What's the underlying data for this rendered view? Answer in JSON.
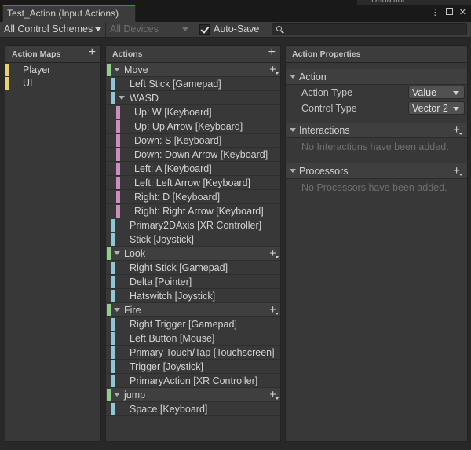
{
  "window": {
    "tab_title": "Test_Action (Input Actions)",
    "ghost_tab": "Behavior"
  },
  "toolbar": {
    "control_schemes": "All Control Schemes",
    "devices": "All Devices",
    "auto_save_label": "Auto-Save",
    "auto_save_checked": true,
    "search_placeholder": ""
  },
  "action_maps": {
    "header": "Action Maps",
    "items": [
      {
        "label": "Player"
      },
      {
        "label": "UI"
      }
    ]
  },
  "actions": {
    "header": "Actions",
    "move": {
      "label": "Move",
      "b_left_stick": "Left Stick [Gamepad]",
      "wasd": "WASD",
      "p_up_w": "Up: W [Keyboard]",
      "p_up_arrow": "Up: Up Arrow [Keyboard]",
      "p_down_s": "Down: S [Keyboard]",
      "p_down_arrow": "Down: Down Arrow [Keyboard]",
      "p_left_a": "Left: A [Keyboard]",
      "p_left_arrow": "Left: Left Arrow [Keyboard]",
      "p_right_d": "Right: D [Keyboard]",
      "p_right_arrow": "Right: Right Arrow [Keyboard]",
      "b_primary2d": "Primary2DAxis [XR Controller]",
      "b_stick_joystick": "Stick [Joystick]"
    },
    "look": {
      "label": "Look",
      "b_right_stick": "Right Stick [Gamepad]",
      "b_delta": "Delta [Pointer]",
      "b_hatswitch": "Hatswitch [Joystick]"
    },
    "fire": {
      "label": "Fire",
      "b_right_trigger": "Right Trigger [Gamepad]",
      "b_left_button": "Left Button [Mouse]",
      "b_primary_touch": "Primary Touch/Tap [Touchscreen]",
      "b_trigger": "Trigger [Joystick]",
      "b_primary_action": "PrimaryAction [XR Controller]"
    },
    "jump": {
      "label": "jump",
      "b_space": "Space [Keyboard]"
    }
  },
  "properties": {
    "header": "Action Properties",
    "action_section": "Action",
    "action_type_label": "Action Type",
    "action_type_value": "Value",
    "control_type_label": "Control Type",
    "control_type_value": "Vector 2",
    "interactions_section": "Interactions",
    "interactions_empty": "No Interactions have been added.",
    "processors_section": "Processors",
    "processors_empty": "No Processors have been added."
  },
  "colors": {
    "map_marker": "#e8d36b",
    "action_marker": "#8fce8a",
    "binding_marker": "#8fc8d4",
    "composite_part_marker": "#c98fbe",
    "tab_accent": "#3a79bb"
  }
}
